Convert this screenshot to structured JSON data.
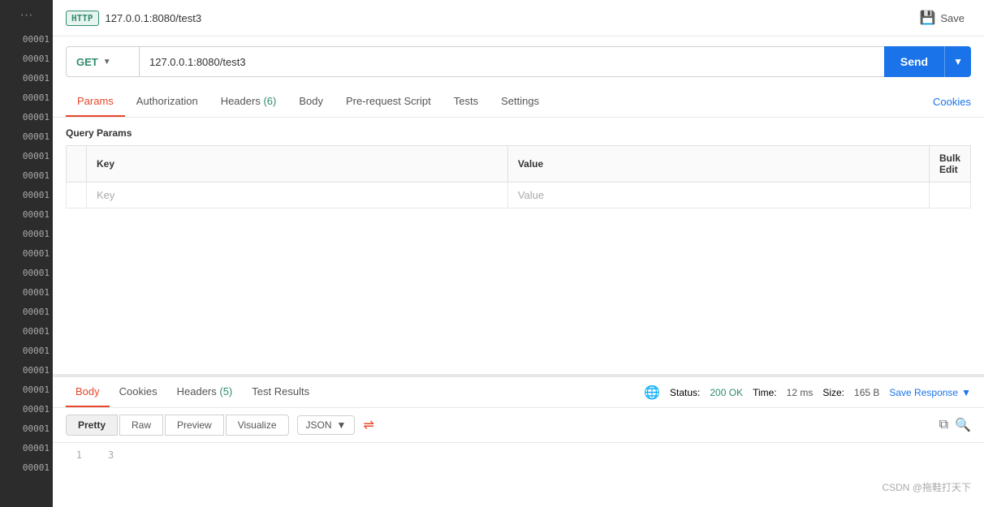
{
  "topbar": {
    "http_badge": "HTTP",
    "url_title": "127.0.0.1:8080/test3",
    "save_label": "Save"
  },
  "request": {
    "method": "GET",
    "url": "127.0.0.1:8080/test3",
    "send_label": "Send"
  },
  "tabs": {
    "params_label": "Params",
    "authorization_label": "Authorization",
    "headers_label": "Headers",
    "headers_count": "(6)",
    "body_label": "Body",
    "prerequest_label": "Pre-request Script",
    "tests_label": "Tests",
    "settings_label": "Settings",
    "cookies_label": "Cookies"
  },
  "query_params": {
    "section_title": "Query Params",
    "col_checkbox": "",
    "col_key": "Key",
    "col_value": "Value",
    "col_bulk": "Bulk Edit",
    "placeholder_key": "Key",
    "placeholder_value": "Value"
  },
  "response": {
    "body_tab": "Body",
    "cookies_tab": "Cookies",
    "headers_tab": "Headers",
    "headers_count": "(5)",
    "test_results_tab": "Test Results",
    "status_label": "Status:",
    "status_value": "200 OK",
    "time_label": "Time:",
    "time_value": "12 ms",
    "size_label": "Size:",
    "size_value": "165 B",
    "save_response_label": "Save Response",
    "pretty_label": "Pretty",
    "raw_label": "Raw",
    "preview_label": "Preview",
    "visualize_label": "Visualize",
    "format_label": "JSON",
    "line1_num": "1",
    "line2_num": "3"
  },
  "watermark": "CSDN @拖鞋打天下"
}
